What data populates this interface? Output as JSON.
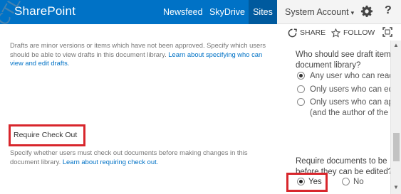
{
  "suite": {
    "brand": "SharePoint",
    "nav": [
      "Newsfeed",
      "SkyDrive",
      "Sites"
    ],
    "account": "System Account",
    "account_caret": "▾",
    "help": "?"
  },
  "watermark": "CTL.VI",
  "actions": {
    "share": "SHARE",
    "follow": "FOLLOW"
  },
  "drafts": {
    "description": "Drafts are minor versions or items which have not been approved. Specify which users should be able to view drafts in this document library.",
    "link": "Learn about specifying who can view and edit drafts.",
    "question": "Who should see draft item",
    "question_line2": "document library?",
    "options": [
      {
        "label": "Any user who can read",
        "checked": true
      },
      {
        "label": "Only users who can ed",
        "checked": false
      },
      {
        "label": "Only users who can ap",
        "label_line2": "(and the author of the",
        "checked": false
      }
    ]
  },
  "checkout": {
    "title": "Require Check Out",
    "description": "Specify whether users must check out documents before making changes in this document library.",
    "link": "Learn about requiring check out.",
    "question": "Require documents to be",
    "question_line2": "before they can be edited?",
    "yes": "Yes",
    "no": "No",
    "selected": "Yes"
  },
  "colors": {
    "suite_blue": "#0072c6",
    "selected_nav": "#005a9e",
    "highlight_red": "#d8262c",
    "link_blue": "#0072c6"
  }
}
